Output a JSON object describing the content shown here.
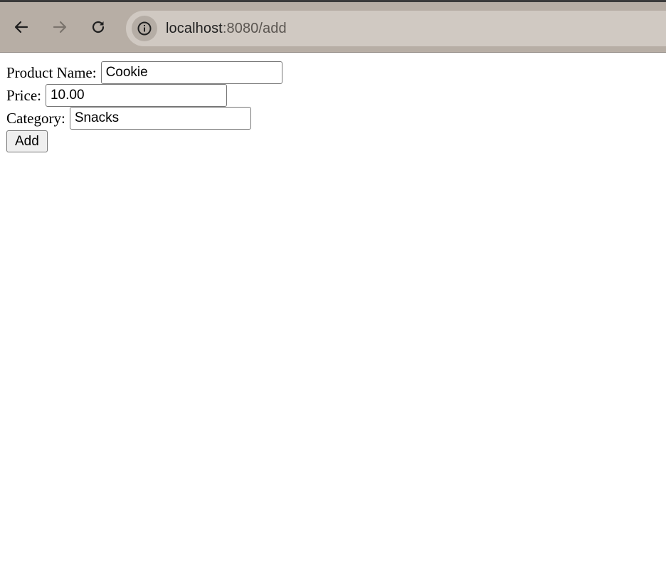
{
  "browser": {
    "url_host": "localhost",
    "url_rest": ":8080/add",
    "back_icon": "arrow-left-icon",
    "forward_icon": "arrow-right-icon",
    "reload_icon": "reload-icon",
    "site_info_icon": "info-icon",
    "forward_enabled": false
  },
  "form": {
    "product_name": {
      "label": "Product Name:",
      "value": "Cookie"
    },
    "price": {
      "label": "Price:",
      "value": "10.00"
    },
    "category": {
      "label": "Category:",
      "value": "Snacks"
    },
    "submit_label": "Add"
  },
  "colors": {
    "toolbar_bg": "#b7aea5",
    "omnibox_bg": "#d0c9c2"
  }
}
